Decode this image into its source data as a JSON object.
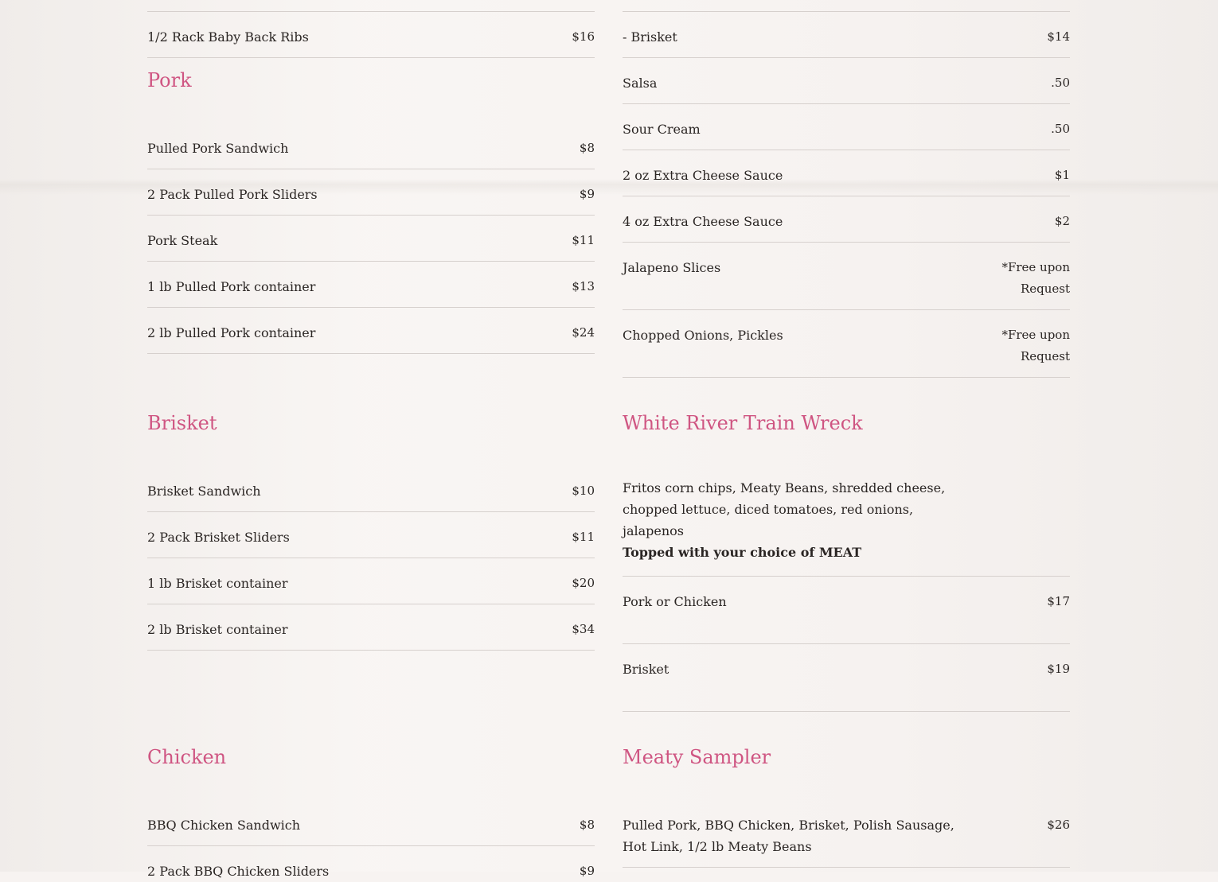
{
  "left": {
    "top_item": {
      "name": "1/2 Rack Baby Back Ribs",
      "price": "$16"
    },
    "pork": {
      "title": "Pork",
      "items": [
        {
          "name": "Pulled Pork Sandwich",
          "price": "$8"
        },
        {
          "name": "2 Pack Pulled Pork Sliders",
          "price": "$9"
        },
        {
          "name": "Pork Steak",
          "price": "$11"
        },
        {
          "name": "1 lb Pulled Pork container",
          "price": "$13"
        },
        {
          "name": "2 lb Pulled Pork container",
          "price": "$24"
        }
      ]
    },
    "brisket": {
      "title": "Brisket",
      "items": [
        {
          "name": "Brisket Sandwich",
          "price": "$10"
        },
        {
          "name": "2 Pack Brisket Sliders",
          "price": "$11"
        },
        {
          "name": "1 lb Brisket container",
          "price": "$20"
        },
        {
          "name": "2 lb Brisket container",
          "price": "$34"
        }
      ]
    },
    "chicken": {
      "title": "Chicken",
      "items": [
        {
          "name": "BBQ Chicken Sandwich",
          "price": "$8"
        },
        {
          "name": "2 Pack BBQ Chicken Sliders",
          "price": "$9"
        }
      ]
    }
  },
  "right": {
    "addons": [
      {
        "name": "- Brisket",
        "price": "$14"
      },
      {
        "name": "Salsa",
        "price": ".50"
      },
      {
        "name": "Sour Cream",
        "price": ".50"
      },
      {
        "name": "2 oz Extra Cheese Sauce",
        "price": "$1"
      },
      {
        "name": "4 oz Extra Cheese Sauce",
        "price": "$2"
      },
      {
        "name": "Jalapeno Slices",
        "price": "*Free upon Request"
      },
      {
        "name": "Chopped Onions, Pickles",
        "price": "*Free upon Request"
      }
    ],
    "train_wreck": {
      "title": "White River Train Wreck",
      "description": "Fritos corn chips, Meaty Beans, shredded cheese, chopped lettuce, diced tomatoes, red onions, jalapenos",
      "description_bold": "Topped with your choice of MEAT",
      "items": [
        {
          "name": "Pork or Chicken",
          "price": "$17"
        },
        {
          "name": "Brisket",
          "price": "$19"
        }
      ]
    },
    "sampler": {
      "title": "Meaty Sampler",
      "items": [
        {
          "name": "Pulled Pork, BBQ Chicken, Brisket, Polish Sausage, Hot Link, 1/2 lb Meaty Beans",
          "price": "$26"
        }
      ]
    }
  }
}
